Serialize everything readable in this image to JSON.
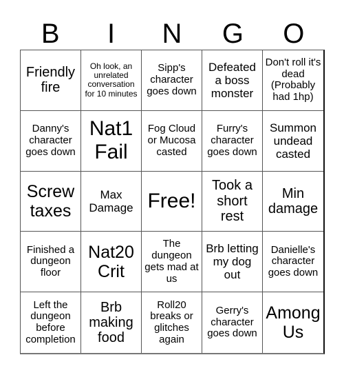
{
  "title_letters": [
    "B",
    "I",
    "N",
    "G",
    "O"
  ],
  "cells": [
    {
      "text": "Friendly fire",
      "size": "s-lg"
    },
    {
      "text": "Oh look, an unrelated conversation for 10 minutes",
      "size": "s-xs"
    },
    {
      "text": "Sipp's character goes down",
      "size": "s-sm"
    },
    {
      "text": "Defeated a boss monster",
      "size": "s-md"
    },
    {
      "text": "Don't roll it's dead (Probably had 1hp)",
      "size": "s-sm"
    },
    {
      "text": "Danny's character goes down",
      "size": "s-sm"
    },
    {
      "text": "Nat1 Fail",
      "size": "s-xxl"
    },
    {
      "text": "Fog Cloud or Mucosa casted",
      "size": "s-sm"
    },
    {
      "text": "Furry's character goes down",
      "size": "s-sm"
    },
    {
      "text": "Summon undead casted",
      "size": "s-md"
    },
    {
      "text": "Screw taxes",
      "size": "s-xl"
    },
    {
      "text": "Max Damage",
      "size": "s-md"
    },
    {
      "text": "Free!",
      "size": "s-xxl"
    },
    {
      "text": "Took a short rest",
      "size": "s-lg"
    },
    {
      "text": "Min damage",
      "size": "s-lg"
    },
    {
      "text": "Finished a dungeon floor",
      "size": "s-sm"
    },
    {
      "text": "Nat20 Crit",
      "size": "s-xl"
    },
    {
      "text": "The dungeon gets mad at us",
      "size": "s-sm"
    },
    {
      "text": "Brb letting my dog out",
      "size": "s-md"
    },
    {
      "text": "Danielle's character goes down",
      "size": "s-sm"
    },
    {
      "text": "Left the dungeon before completion",
      "size": "s-sm"
    },
    {
      "text": "Brb making food",
      "size": "s-lg"
    },
    {
      "text": "Roll20 breaks or glitches again",
      "size": "s-sm"
    },
    {
      "text": "Gerry's character goes down",
      "size": "s-sm"
    },
    {
      "text": "Among Us",
      "size": "s-xl"
    }
  ]
}
